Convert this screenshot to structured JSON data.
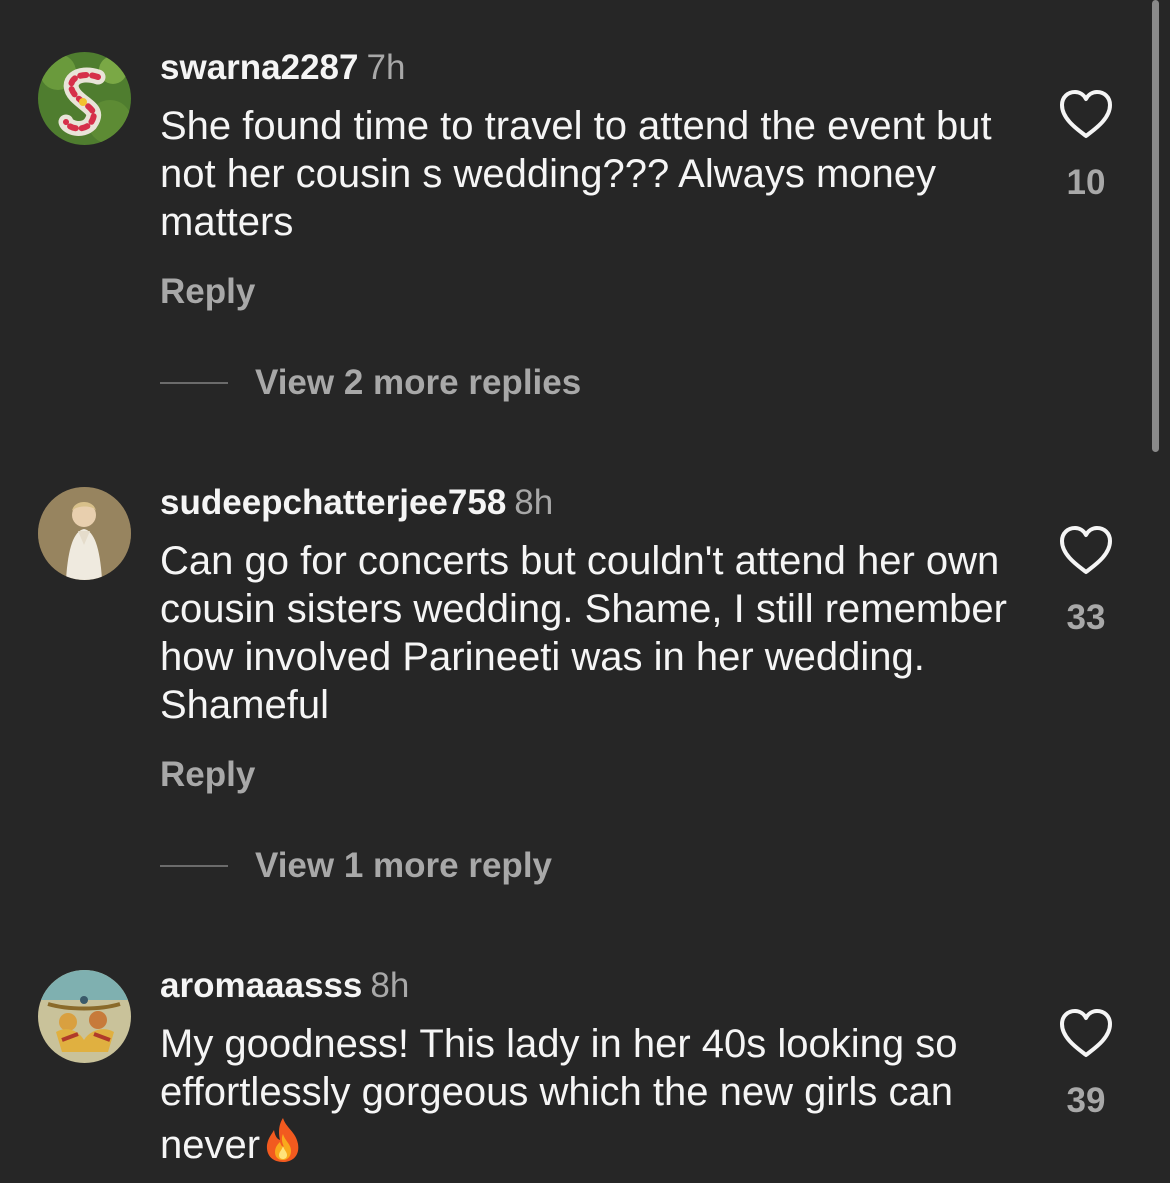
{
  "comments": [
    {
      "username": "swarna2287",
      "time": "7h",
      "text": "She found time to travel to attend the event but not her cousin s wedding??? Always money matters",
      "reply_label": "Reply",
      "view_replies": "View 2 more replies",
      "likes": "10"
    },
    {
      "username": "sudeepchatterjee758",
      "time": "8h",
      "text": "Can go for concerts but couldn't attend her own cousin sisters wedding. Shame, I still remember how involved Parineeti was in her wedding. Shameful",
      "reply_label": "Reply",
      "view_replies": "View 1 more reply",
      "likes": "33"
    },
    {
      "username": "aromaaasss",
      "time": "8h",
      "text": "My goodness! This lady in her 40s looking so effortlessly gorgeous which the new girls can never",
      "emoji": "fire-emoji",
      "likes": "39"
    }
  ],
  "icons": {
    "like": "heart-outline-icon"
  },
  "colors": {
    "background": "#262626",
    "primary_text": "#f5f5f5",
    "secondary_text": "#a8a8a8"
  }
}
